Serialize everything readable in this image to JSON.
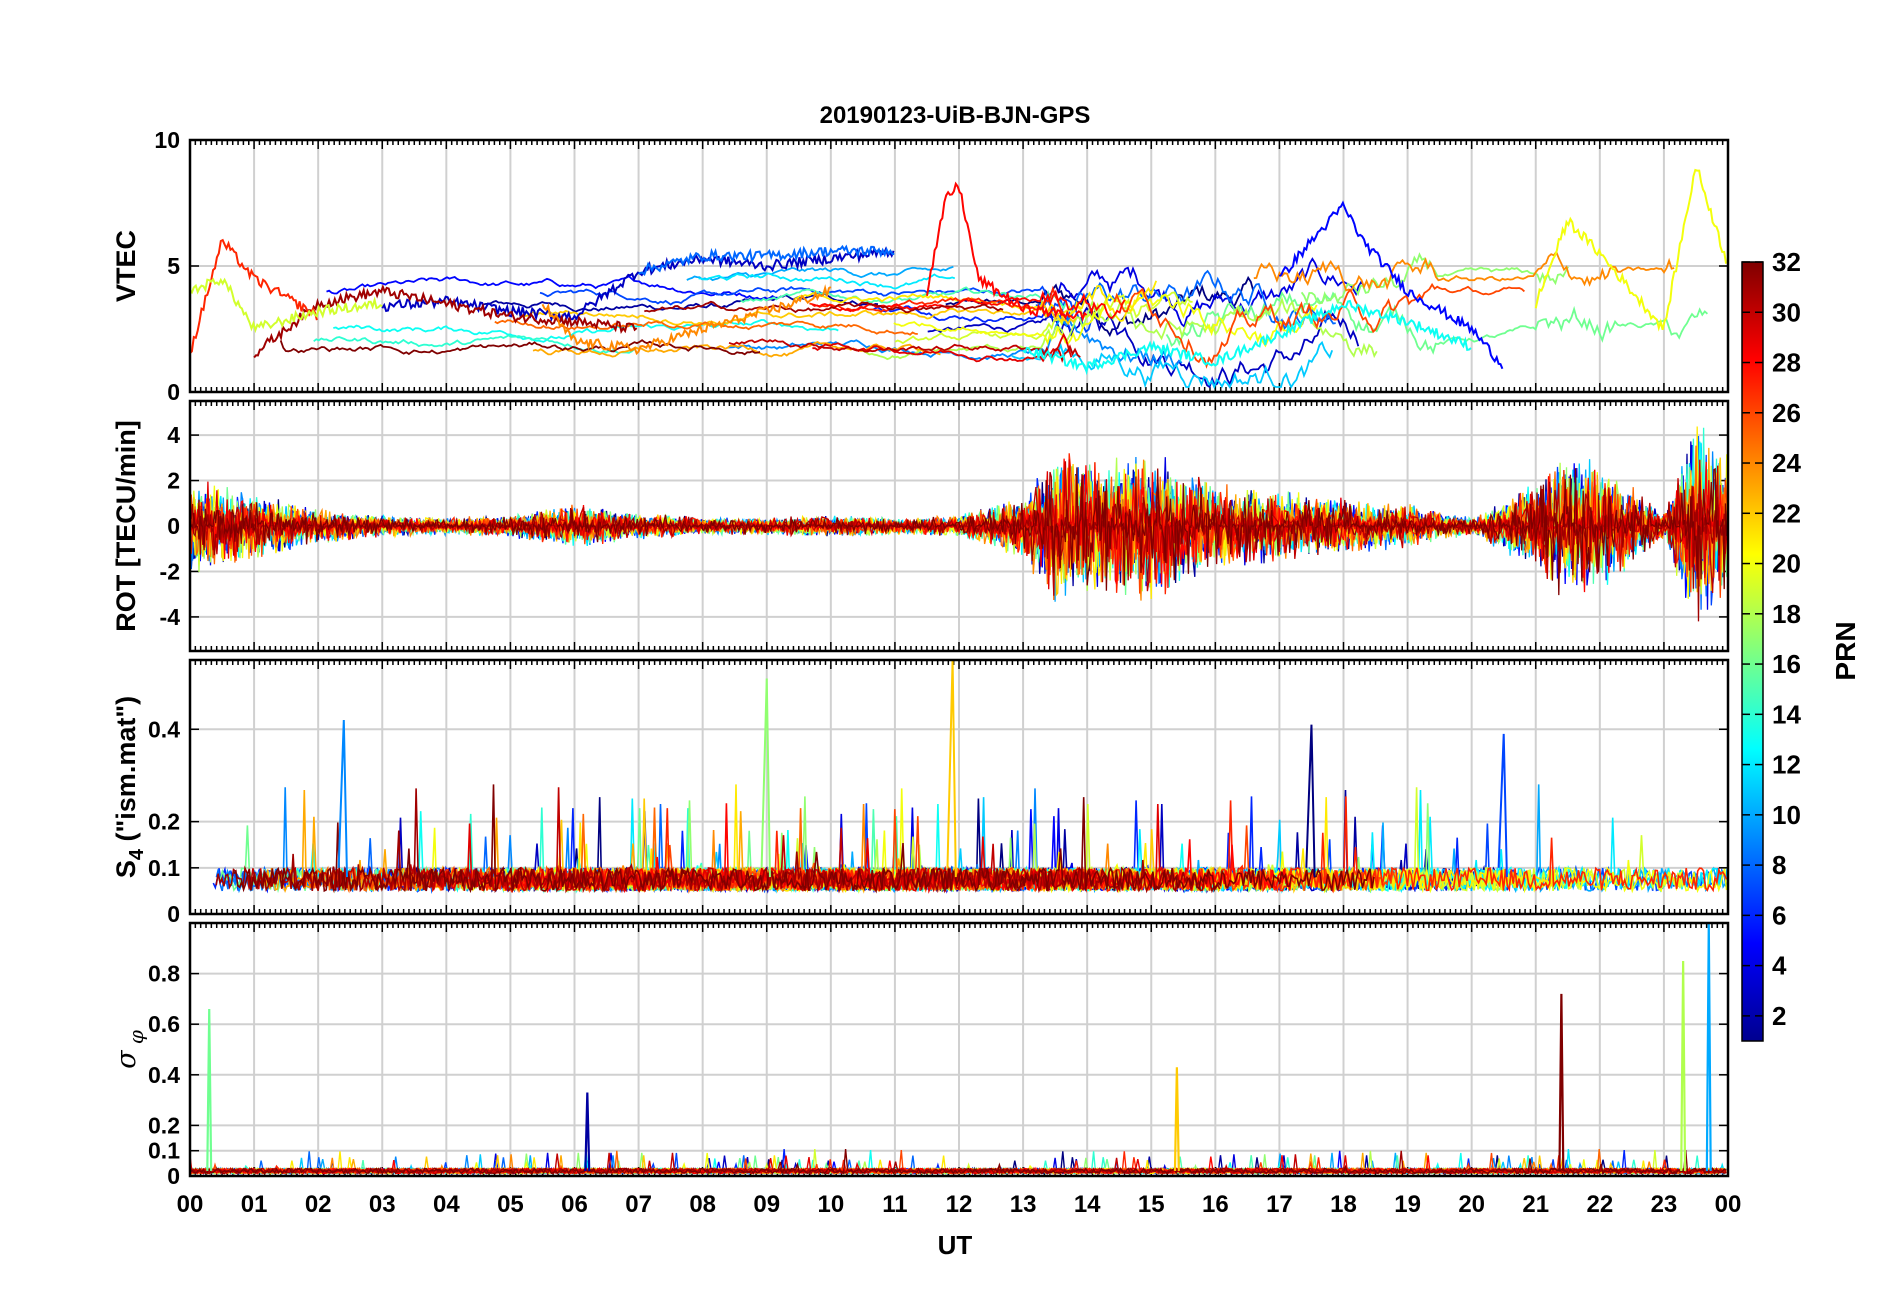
{
  "title": "20190123-UiB-BJN-GPS",
  "xlabel": "UT",
  "x_ticklabels": [
    "00",
    "01",
    "02",
    "03",
    "04",
    "05",
    "06",
    "07",
    "08",
    "09",
    "10",
    "11",
    "12",
    "13",
    "14",
    "15",
    "16",
    "17",
    "18",
    "19",
    "20",
    "21",
    "22",
    "23",
    "00"
  ],
  "colorbar": {
    "label": "PRN",
    "range": [
      1,
      32
    ],
    "colormap": "jet",
    "ticks": [
      "2",
      "4",
      "6",
      "8",
      "10",
      "12",
      "14",
      "16",
      "18",
      "20",
      "22",
      "24",
      "26",
      "28",
      "30",
      "32"
    ]
  },
  "chart_data": [
    {
      "type": "line",
      "panel": "vtec",
      "ylabel": "VTEC",
      "ylim": [
        0,
        10
      ],
      "yticks": [
        "0",
        "5",
        "10"
      ],
      "xlim_hours": [
        0,
        24
      ],
      "series_color_by": "PRN",
      "series": [
        {
          "prn": 3,
          "x": [
            3.0,
            4.0,
            5.0,
            6.0,
            7.0,
            8.0,
            9.0,
            10.0,
            11.0
          ],
          "values": [
            3.4,
            3.6,
            3.2,
            3.0,
            4.8,
            5.3,
            5.0,
            5.3,
            5.6
          ]
        },
        {
          "prn": 8,
          "x": [
            7.0,
            8.0,
            9.0,
            10.0,
            11.0
          ],
          "values": [
            4.8,
            5.4,
            5.4,
            5.6,
            5.6
          ]
        },
        {
          "prn": 5,
          "x": [
            17.0,
            17.5,
            18.0,
            18.3,
            19.0,
            20.0,
            20.5
          ],
          "values": [
            4.5,
            6.0,
            7.4,
            6.0,
            4.0,
            2.5,
            1.0
          ]
        },
        {
          "prn": 28,
          "x": [
            11.5,
            11.8,
            12.0,
            12.3,
            13.0,
            14.0
          ],
          "values": [
            4.0,
            7.7,
            8.2,
            4.5,
            3.3,
            3.0
          ]
        },
        {
          "prn": 20,
          "x": [
            21.0,
            21.5,
            22.0,
            23.0,
            23.5,
            24.0
          ],
          "values": [
            3.5,
            6.8,
            5.5,
            2.5,
            9.0,
            5.0
          ]
        },
        {
          "prn": 31,
          "x": [
            1.0,
            2.0,
            3.0,
            4.0,
            5.0,
            6.0,
            7.0
          ],
          "values": [
            1.5,
            3.5,
            4.0,
            3.5,
            3.0,
            2.8,
            2.5
          ]
        },
        {
          "prn": 24,
          "x": [
            5.5,
            6.0,
            7.0,
            8.0,
            9.0,
            10.0
          ],
          "values": [
            3.5,
            2.0,
            1.7,
            2.5,
            3.2,
            4.0
          ]
        },
        {
          "prn": 13,
          "x": [
            13.0,
            14.0,
            15.0,
            16.0,
            17.0,
            18.0,
            19.0,
            20.0
          ],
          "values": [
            1.7,
            1.0,
            1.8,
            1.2,
            2.3,
            3.5,
            2.8,
            1.8
          ]
        },
        {
          "prn": 27,
          "x": [
            0.0,
            0.5,
            1.0,
            2.0
          ],
          "values": [
            1.5,
            6.0,
            4.5,
            3.0
          ]
        },
        {
          "prn": 19,
          "x": [
            0.0,
            0.5,
            1.0,
            2.0,
            3.0
          ],
          "values": [
            4.0,
            4.5,
            2.5,
            3.2,
            3.5
          ]
        }
      ]
    },
    {
      "type": "line",
      "panel": "rot",
      "ylabel": "ROT [TECU/min]",
      "ylim": [
        -5.5,
        5.5
      ],
      "yticks": [
        "-4",
        "-2",
        "0",
        "2",
        "4"
      ],
      "xlim_hours": [
        0,
        24
      ],
      "activity_envelope": {
        "x": [
          0,
          1,
          2,
          3,
          4,
          5,
          6,
          7,
          8,
          9,
          10,
          11,
          12,
          13,
          13.5,
          14,
          15,
          16,
          17,
          18,
          19,
          20,
          21,
          21.5,
          22,
          23,
          23.5,
          24
        ],
        "values": [
          2.2,
          1.5,
          0.8,
          0.5,
          0.4,
          0.5,
          1.0,
          0.6,
          0.4,
          0.4,
          0.5,
          0.4,
          0.5,
          1.5,
          3.8,
          3.2,
          3.5,
          2.0,
          1.6,
          1.3,
          1.0,
          0.4,
          2.0,
          3.5,
          3.0,
          0.6,
          5.0,
          3.5
        ]
      }
    },
    {
      "type": "line",
      "panel": "s4",
      "ylabel": "S4 (\"ism.mat\")",
      "ylim": [
        0,
        0.55
      ],
      "yticks": [
        "0",
        "0.1",
        "0.2",
        "0.4"
      ],
      "xlim_hours": [
        0,
        24
      ],
      "notable_peaks": [
        {
          "x": 2.4,
          "value": 0.42
        },
        {
          "x": 9.0,
          "value": 0.51
        },
        {
          "x": 11.9,
          "value": 0.55
        },
        {
          "x": 17.5,
          "value": 0.41
        },
        {
          "x": 20.5,
          "value": 0.39
        }
      ]
    },
    {
      "type": "line",
      "panel": "sigma_phi",
      "ylabel": "σ φ",
      "ylim": [
        0,
        1
      ],
      "yticks": [
        "0",
        "0.1",
        "0.2",
        "0.4",
        "0.6",
        "0.8"
      ],
      "xlim_hours": [
        0,
        24
      ],
      "notable_peaks": [
        {
          "x": 0.3,
          "value": 0.66
        },
        {
          "x": 6.2,
          "value": 0.33
        },
        {
          "x": 15.4,
          "value": 0.43
        },
        {
          "x": 21.4,
          "value": 0.72
        },
        {
          "x": 23.3,
          "value": 0.85
        },
        {
          "x": 23.7,
          "value": 1.0
        }
      ]
    }
  ]
}
